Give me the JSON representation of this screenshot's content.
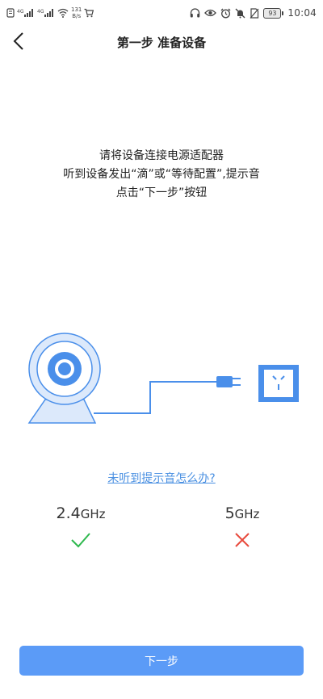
{
  "status_bar": {
    "net_speed_value": "131",
    "net_speed_unit": "B/s",
    "battery": "93",
    "time": "10:04",
    "left_icons": [
      "notification-icon",
      "signal-4g-icon",
      "signal-4g-icon",
      "wifi-icon",
      "cart-icon"
    ],
    "right_icons": [
      "headphone-icon",
      "eye-icon",
      "alarm-icon",
      "mute-icon",
      "no-sim-icon"
    ]
  },
  "nav": {
    "back_icon": "chevron-left-icon",
    "title": "第一步 准备设备"
  },
  "instructions": {
    "line1": "请将设备连接电源适配器",
    "line2": "听到设备发出“滴”或“等待配置”,提示音",
    "line3": "点击“下一步”按钮"
  },
  "illustration": {
    "items": [
      "camera-icon",
      "cable",
      "plug-icon",
      "power-outlet-icon"
    ]
  },
  "help_link": "未听到提示音怎么办?",
  "frequencies": [
    {
      "value": "2.4",
      "unit": "GHz",
      "supported": true,
      "mark_icon": "check-icon",
      "color": "#2db84d"
    },
    {
      "value": "5",
      "unit": "GHz",
      "supported": false,
      "mark_icon": "cross-icon",
      "color": "#e84a3c"
    }
  ],
  "next_button": {
    "label": "下一步",
    "color": "#5b9bf7"
  },
  "colors": {
    "accent": "#5b9bf7",
    "link": "#4a90e2",
    "illustration_blue": "#4a8fea",
    "illustration_light": "#dce9fb"
  }
}
